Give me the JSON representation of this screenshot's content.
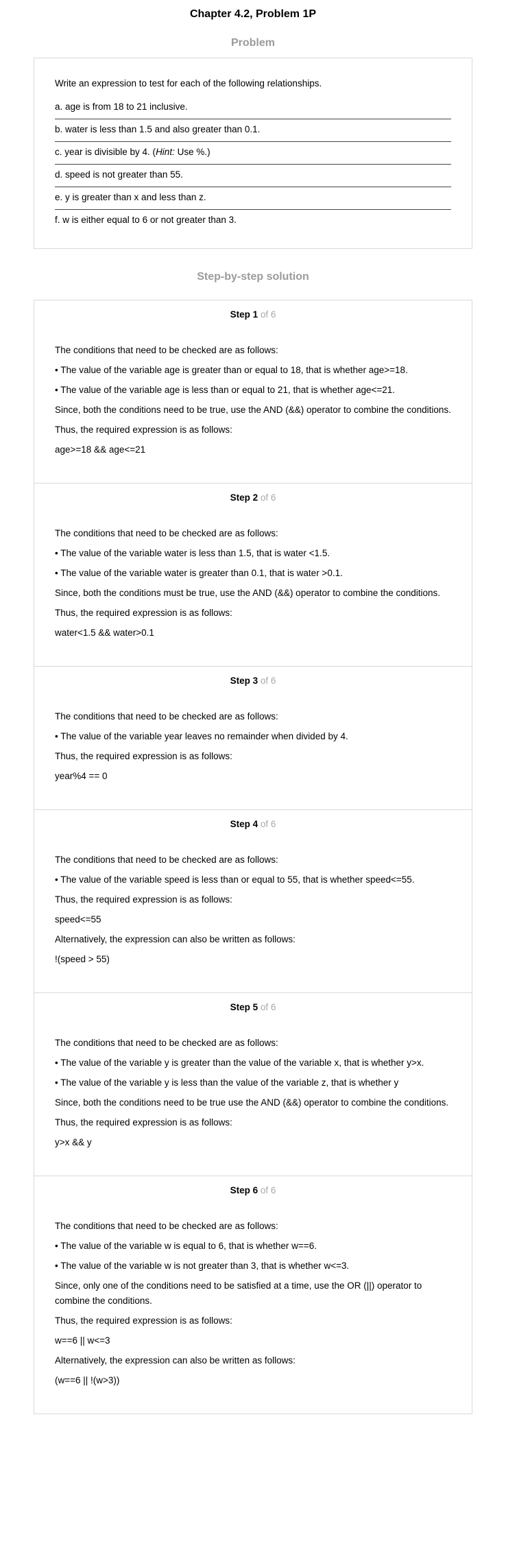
{
  "header": {
    "chapter_title": "Chapter 4.2, Problem 1P",
    "problem_heading": "Problem",
    "solution_heading": "Step-by-step solution"
  },
  "problem": {
    "intro": "Write an expression to test for each of the following relationships.",
    "parts": [
      {
        "text": "a. age is from 18 to 21 inclusive."
      },
      {
        "text": "b. water is less than 1.5 and also greater than 0.1."
      },
      {
        "text_before": "c. year is divisible by 4. (",
        "hint_label": "Hint:",
        "text_after": " Use %.)"
      },
      {
        "text": "d. speed is not greater than 55."
      },
      {
        "text": "e. y is greater than x and less than z."
      },
      {
        "text": "f. w is either equal to 6 or not greater than 3."
      }
    ]
  },
  "steps": [
    {
      "label": "Step 1",
      "of": "of 6",
      "lines": [
        "The conditions that need to be checked are as follows:",
        "• The value of the variable age is greater than or equal to 18, that is whether age>=18.",
        "• The value of the variable age is less than or equal to 21, that is whether age<=21.",
        "Since, both the conditions need to be true, use the AND (&&) operator to combine the conditions.",
        "Thus, the required expression is as follows:",
        "age>=18 && age<=21"
      ]
    },
    {
      "label": "Step 2",
      "of": "of 6",
      "lines": [
        "The conditions that need to be checked are as follows:",
        "• The value of the variable water is less than 1.5, that is water <1.5.",
        "• The value of the variable water is greater than 0.1, that is water >0.1.",
        "Since, both the conditions must be true, use the AND (&&) operator to combine the conditions.",
        "Thus, the required expression is as follows:",
        "water<1.5 && water>0.1"
      ]
    },
    {
      "label": "Step 3",
      "of": "of 6",
      "lines": [
        "The conditions that need to be checked are as follows:",
        "• The value of the variable year leaves no remainder when divided by 4.",
        "Thus, the required expression is as follows:",
        "year%4 == 0"
      ]
    },
    {
      "label": "Step 4",
      "of": "of 6",
      "lines": [
        "The conditions that need to be checked are as follows:",
        "• The value of the variable speed is less than or equal to 55, that is whether speed<=55.",
        "Thus, the required expression is as follows:",
        "speed<=55",
        "Alternatively, the expression can also be written as follows:",
        "!(speed > 55)"
      ]
    },
    {
      "label": "Step 5",
      "of": "of 6",
      "lines": [
        "The conditions that need to be checked are as follows:",
        "• The value of the variable y is greater than the value of the variable x, that is whether y>x.",
        "• The value of the variable y is less than the value of the variable z, that is whether y",
        "Since, both the conditions need to be true use the AND (&&) operator to combine the conditions.",
        "Thus, the required expression is as follows:",
        "y>x && y"
      ]
    },
    {
      "label": "Step 6",
      "of": "of 6",
      "lines": [
        "The conditions that need to be checked are as follows:",
        "• The value of the variable w is equal to 6, that is whether w==6.",
        "• The value of the variable w is not greater than 3, that is whether w<=3.",
        "Since, only one of the conditions need to be satisfied at a time, use the OR (||) operator to combine the conditions.",
        "Thus, the required expression is as follows:",
        "w==6 || w<=3",
        "Alternatively, the expression can also be written as follows:",
        "(w==6 || !(w>3))"
      ]
    }
  ]
}
